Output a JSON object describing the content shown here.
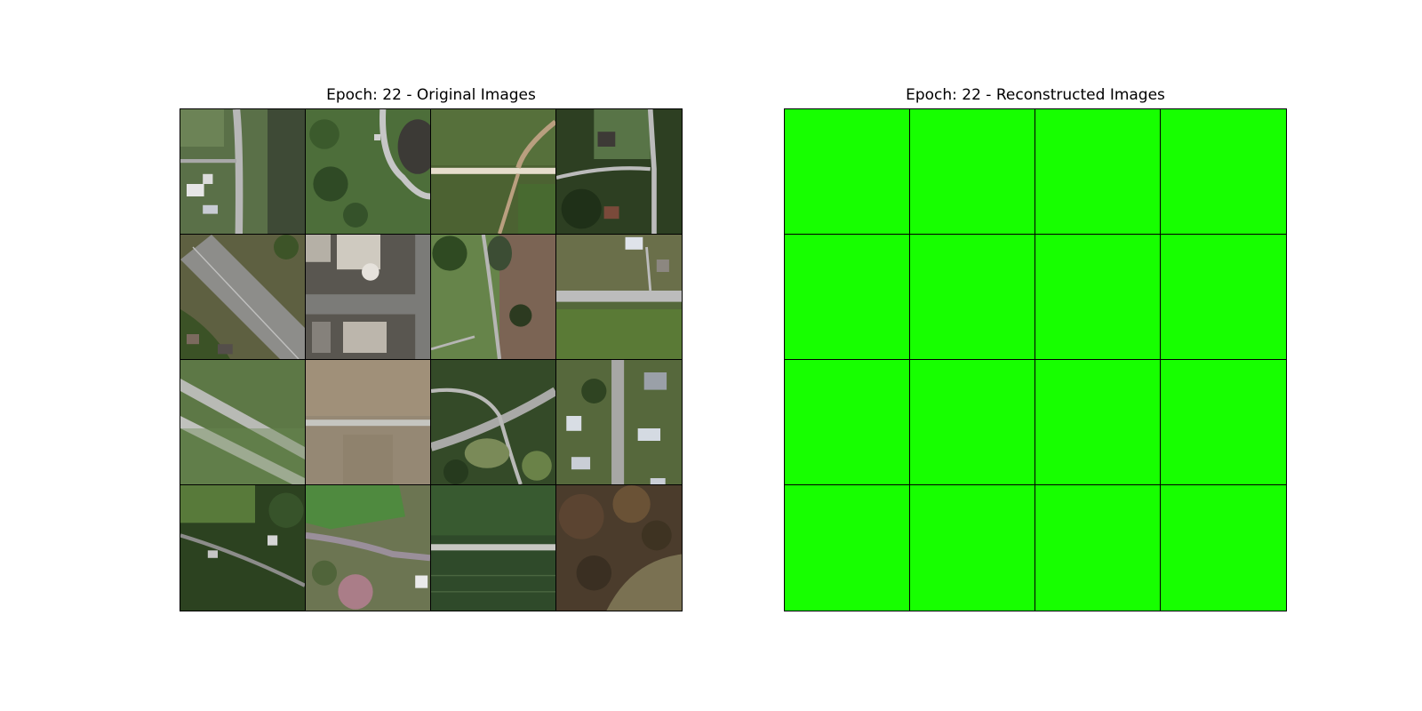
{
  "figure": {
    "left_title": "Epoch: 22 - Original Images",
    "right_title": "Epoch: 22 - Reconstructed Images",
    "grid_rows": 4,
    "grid_cols": 4
  },
  "original_images": [
    {
      "name": "aerial-tile-1",
      "scene": "road-with-houses"
    },
    {
      "name": "aerial-tile-2",
      "scene": "curved-road-pond"
    },
    {
      "name": "aerial-tile-3",
      "scene": "field-road"
    },
    {
      "name": "aerial-tile-4",
      "scene": "houses-trees"
    },
    {
      "name": "aerial-tile-5",
      "scene": "highway"
    },
    {
      "name": "aerial-tile-6",
      "scene": "urban-intersection"
    },
    {
      "name": "aerial-tile-7",
      "scene": "park-pond"
    },
    {
      "name": "aerial-tile-8",
      "scene": "rural-road-field"
    },
    {
      "name": "aerial-tile-9",
      "scene": "diagonal-highway-field"
    },
    {
      "name": "aerial-tile-10",
      "scene": "dry-field-road"
    },
    {
      "name": "aerial-tile-11",
      "scene": "road-junction"
    },
    {
      "name": "aerial-tile-12",
      "scene": "suburban-street"
    },
    {
      "name": "aerial-tile-13",
      "scene": "forest-houses"
    },
    {
      "name": "aerial-tile-14",
      "scene": "field-road-trees"
    },
    {
      "name": "aerial-tile-15",
      "scene": "crop-field-road"
    },
    {
      "name": "aerial-tile-16",
      "scene": "autumn-forest"
    }
  ],
  "reconstructed_color": "#17ff00"
}
